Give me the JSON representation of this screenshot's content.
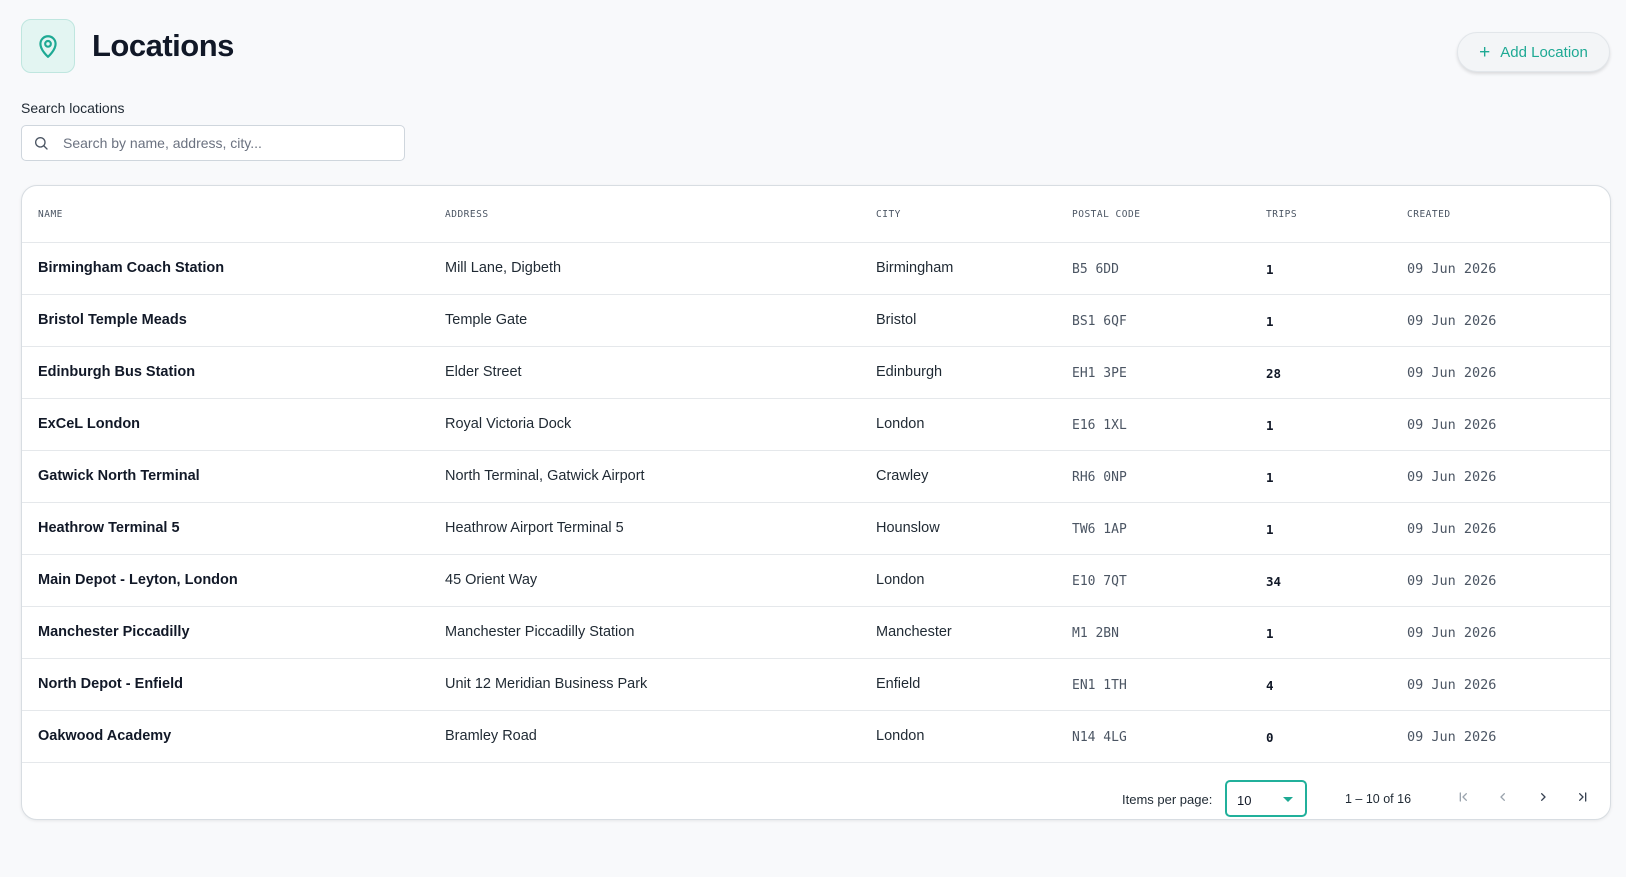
{
  "header": {
    "title": "Locations",
    "icon": "map-pin-icon",
    "add_button_label": "Add Location",
    "add_button_icon": "plus-icon"
  },
  "search": {
    "label": "Search locations",
    "placeholder": "Search by name, address, city...",
    "value": "",
    "icon": "search-icon"
  },
  "table": {
    "columns": [
      "Name",
      "Address",
      "City",
      "Postal Code",
      "Trips",
      "Created"
    ],
    "rows": [
      {
        "name": "Birmingham Coach Station",
        "address": "Mill Lane, Digbeth",
        "city": "Birmingham",
        "postal": "B5 6DD",
        "trips": "1",
        "created": "09 Jun 2026"
      },
      {
        "name": "Bristol Temple Meads",
        "address": "Temple Gate",
        "city": "Bristol",
        "postal": "BS1 6QF",
        "trips": "1",
        "created": "09 Jun 2026"
      },
      {
        "name": "Edinburgh Bus Station",
        "address": "Elder Street",
        "city": "Edinburgh",
        "postal": "EH1 3PE",
        "trips": "28",
        "created": "09 Jun 2026"
      },
      {
        "name": "ExCeL London",
        "address": "Royal Victoria Dock",
        "city": "London",
        "postal": "E16 1XL",
        "trips": "1",
        "created": "09 Jun 2026"
      },
      {
        "name": "Gatwick North Terminal",
        "address": "North Terminal, Gatwick Airport",
        "city": "Crawley",
        "postal": "RH6 0NP",
        "trips": "1",
        "created": "09 Jun 2026"
      },
      {
        "name": "Heathrow Terminal 5",
        "address": "Heathrow Airport Terminal 5",
        "city": "Hounslow",
        "postal": "TW6 1AP",
        "trips": "1",
        "created": "09 Jun 2026"
      },
      {
        "name": "Main Depot - Leyton, London",
        "address": "45 Orient Way",
        "city": "London",
        "postal": "E10 7QT",
        "trips": "34",
        "created": "09 Jun 2026"
      },
      {
        "name": "Manchester Piccadilly",
        "address": "Manchester Piccadilly Station",
        "city": "Manchester",
        "postal": "M1 2BN",
        "trips": "1",
        "created": "09 Jun 2026"
      },
      {
        "name": "North Depot - Enfield",
        "address": "Unit 12 Meridian Business Park",
        "city": "Enfield",
        "postal": "EN1 1TH",
        "trips": "4",
        "created": "09 Jun 2026"
      },
      {
        "name": "Oakwood Academy",
        "address": "Bramley Road",
        "city": "London",
        "postal": "N14 4LG",
        "trips": "0",
        "created": "09 Jun 2026"
      }
    ]
  },
  "paginator": {
    "items_per_page_label": "Items per page:",
    "items_per_page_value": "10",
    "range_label": "1 – 10 of 16",
    "buttons": [
      "first-page-icon",
      "previous-page-icon",
      "next-page-icon",
      "last-page-icon"
    ]
  },
  "colors": {
    "accent": "#1ea994",
    "icon_bg": "#e3f5f2",
    "page_bg": "#f8f9fb"
  }
}
